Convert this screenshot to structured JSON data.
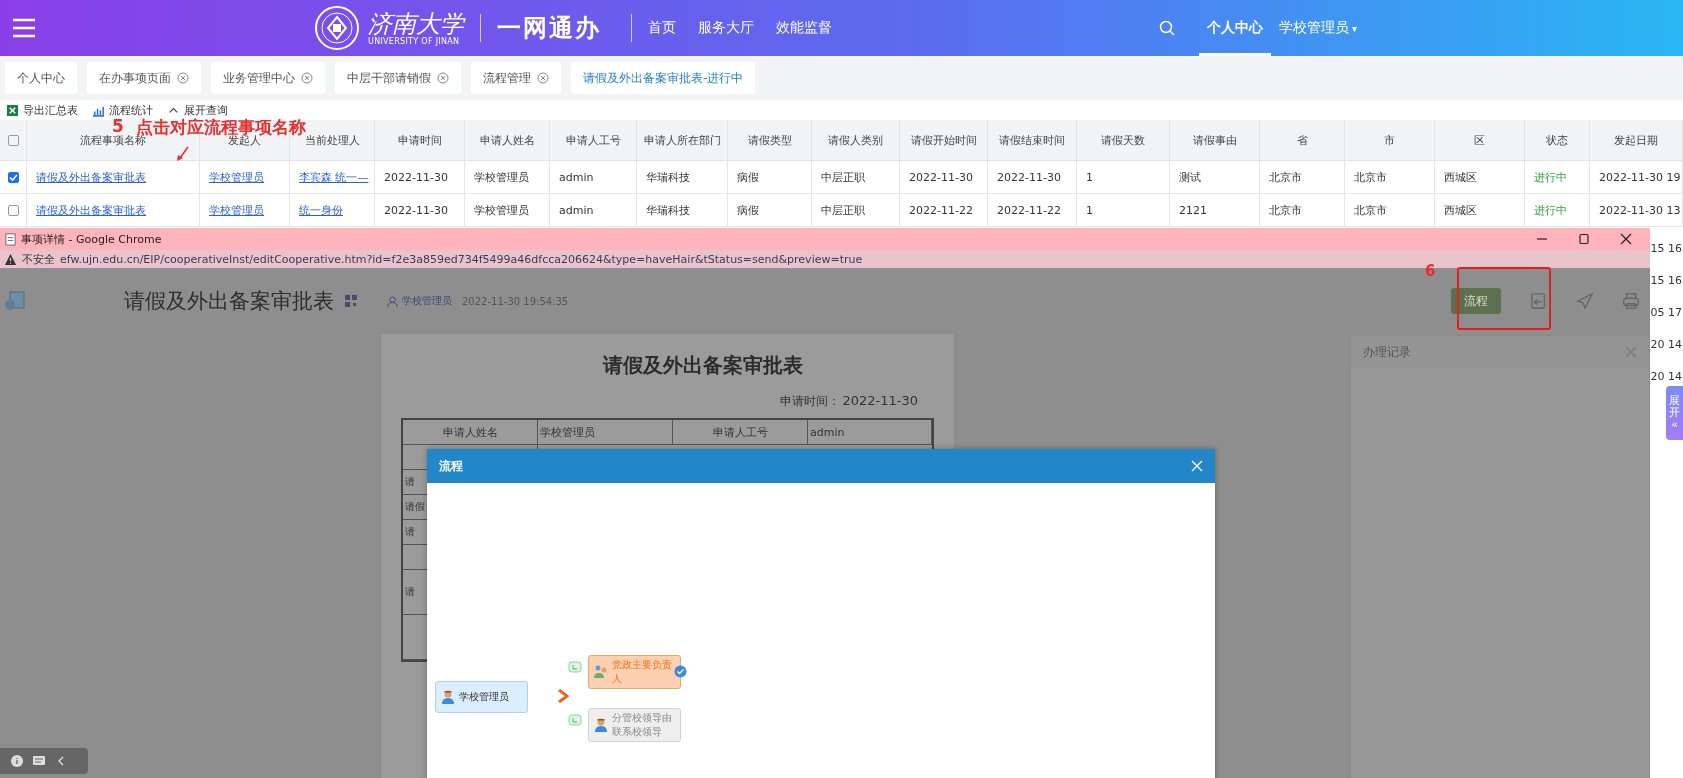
{
  "header": {
    "logo_name": "济南大学",
    "logo_sub": "UNIVERSITY OF JINAN",
    "brand": "一网通办",
    "nav": [
      {
        "label": "首页"
      },
      {
        "label": "服务大厅"
      },
      {
        "label": "效能监督"
      }
    ],
    "user_tabs": [
      {
        "label": "个人中心",
        "selected": true,
        "kind": "tab"
      },
      {
        "label": "学校管理员",
        "selected": false,
        "kind": "dropdown",
        "caret": "▾"
      }
    ]
  },
  "tabs": [
    {
      "label": "个人中心",
      "closable": false,
      "selected": false
    },
    {
      "label": "在办事项页面",
      "closable": true,
      "selected": false
    },
    {
      "label": "业务管理中心",
      "closable": true,
      "selected": false
    },
    {
      "label": "中层干部请销假",
      "closable": true,
      "selected": false
    },
    {
      "label": "流程管理",
      "closable": true,
      "selected": false
    },
    {
      "label": "请假及外出备案审批表-进行中",
      "closable": false,
      "selected": true
    }
  ],
  "toolbar": [
    {
      "kind": "excel",
      "label": "导出汇总表"
    },
    {
      "kind": "chart",
      "label": "流程统计"
    },
    {
      "kind": "expand",
      "label": "展开查询"
    }
  ],
  "table": {
    "select_all": {
      "checked": false
    },
    "columns": [
      "流程事项名称",
      "发起人",
      "当前处理人",
      "申请时间",
      "申请人姓名",
      "申请人工号",
      "申请人所在部门",
      "请假类型",
      "请假人类别",
      "请假开始时间",
      "请假结束时间",
      "请假天数",
      "请假事由",
      "省",
      "市",
      "区",
      "状态",
      "发起日期"
    ],
    "rows": [
      {
        "checked": true,
        "cells": [
          "请假及外出备案审批表",
          "学校管理员",
          "李宾森  统一—",
          "2022-11-30",
          "学校管理员",
          "admin",
          "华瑞科技",
          "病假",
          "中层正职",
          "2022-11-30",
          "2022-11-30",
          "1",
          "测试",
          "北京市",
          "北京市",
          "西城区",
          "进行中",
          "2022-11-30 19"
        ]
      },
      {
        "checked": false,
        "cells": [
          "请假及外出备案审批表",
          "学校管理员",
          "统一身份",
          "2022-11-30",
          "学校管理员",
          "admin",
          "华瑞科技",
          "病假",
          "中层正职",
          "2022-11-22",
          "2022-11-22",
          "1",
          "2121",
          "北京市",
          "北京市",
          "西城区",
          "进行中",
          "2022-11-30 13"
        ]
      }
    ]
  },
  "annotations": [
    {
      "number": "5",
      "text": "点击对应流程事项名称"
    },
    {
      "number": "6"
    }
  ],
  "right_edge": {
    "fragments": [
      "15 16",
      "15 16",
      "05 17",
      "20 14",
      "20 14"
    ],
    "side_tab": {
      "label": "展开",
      "arrow": "«"
    }
  },
  "popup": {
    "title": "事项详情 - Google Chrome",
    "security": "不安全",
    "url": "efw.ujn.edu.cn/EIP/cooperativeInst/editCooperative.htm?id=f2e3a859ed734f5499a46dfcca206624&type=haveHair&tStatus=send&preview=true",
    "doc_header": {
      "title": "请假及外出备案审批表",
      "author": "学校管理员",
      "time": "2022-11-30 19:54:35",
      "button": "流程"
    },
    "paper": {
      "title": "请假及外出备案审批表",
      "date_label": "申请时间：",
      "date": "2022-11-30",
      "first_row": [
        "申请人姓名",
        "学校管理员",
        "申请人工号",
        "admin"
      ],
      "cut_rows": [
        {
          "kind": "short"
        },
        {
          "kind": "short",
          "label": "请"
        },
        {
          "kind": "short",
          "label": "请假"
        },
        {
          "kind": "short",
          "label": "请"
        },
        {
          "kind": "short"
        },
        {
          "kind": "tall",
          "label": "请"
        },
        {
          "kind": "tall"
        }
      ]
    },
    "side_panel": {
      "title": "办理记录"
    },
    "dialog": {
      "title": "流程",
      "start": "学校管理员",
      "branches": [
        {
          "label": "党政主要负责人",
          "kind": "current"
        },
        {
          "label": "分管校领导由联系校领导",
          "kind": "pending"
        }
      ]
    }
  }
}
